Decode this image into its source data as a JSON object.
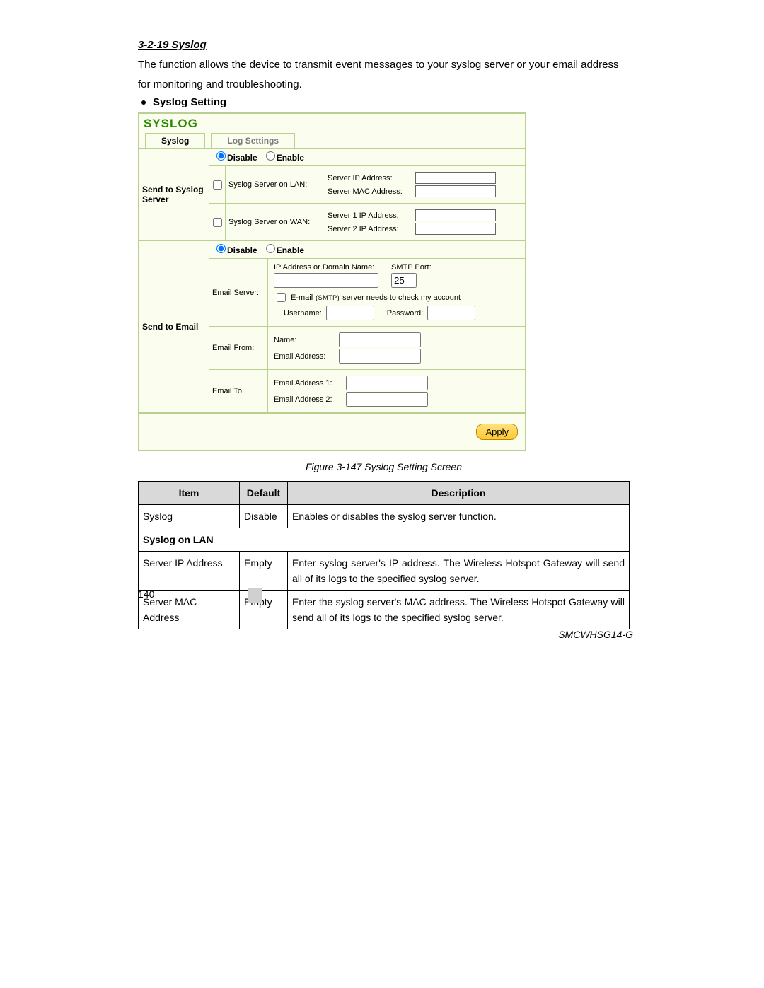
{
  "section_title": "3-2-19 Syslog",
  "intro": "The function allows the device to transmit event messages to your syslog server or your email address for monitoring and troubleshooting.",
  "bullet": "Syslog Setting",
  "panel": {
    "title": "SYSLOG",
    "tabs": {
      "active": "Syslog",
      "inactive": "Log Settings"
    },
    "disable": "Disable",
    "enable": "Enable",
    "send_syslog": {
      "label": "Send to Syslog Server",
      "lan": {
        "label": "Syslog Server on LAN:",
        "ip_label": "Server IP Address:",
        "mac_label": "Server MAC Address:"
      },
      "wan": {
        "label": "Syslog Server on WAN:",
        "ip1_label": "Server 1 IP Address:",
        "ip2_label": "Server 2 IP Address:"
      }
    },
    "send_email": {
      "label": "Send to Email",
      "server": {
        "label": "Email Server:",
        "ip_label": "IP Address or Domain Name:",
        "smtp_label": "SMTP Port:",
        "smtp_value": "25",
        "check_label_pre": "E-mail ",
        "check_label_smtp": "(SMTP)",
        "check_label_post": " server needs to check my account",
        "user_label": "Username:",
        "pass_label": "Password:"
      },
      "from": {
        "label": "Email From:",
        "name_label": "Name:",
        "addr_label": "Email Address:"
      },
      "to": {
        "label": "Email To:",
        "addr1_label": "Email Address 1:",
        "addr2_label": "Email Address 2:"
      }
    },
    "apply": "Apply"
  },
  "figure_caption": "Figure 3-147 Syslog Setting Screen",
  "table": {
    "headers": {
      "item": "Item",
      "default": "Default",
      "description": "Description"
    },
    "rows": [
      {
        "item": "Syslog",
        "default": "Disable",
        "desc": "Enables or disables the syslog server function."
      }
    ],
    "subheader": "Syslog on LAN",
    "rows2": [
      {
        "item": "Server IP Address",
        "default": "Empty",
        "desc": "Enter syslog server's IP address. The Wireless Hotspot Gateway will send all of its logs to the specified syslog server."
      },
      {
        "item": "Server MAC Address",
        "default": "Empty",
        "desc": "Enter the syslog server's MAC address. The Wireless Hotspot Gateway will send all of its logs to the specified syslog server."
      }
    ]
  },
  "page_number": "140",
  "model": "SMCWHSG14-G"
}
